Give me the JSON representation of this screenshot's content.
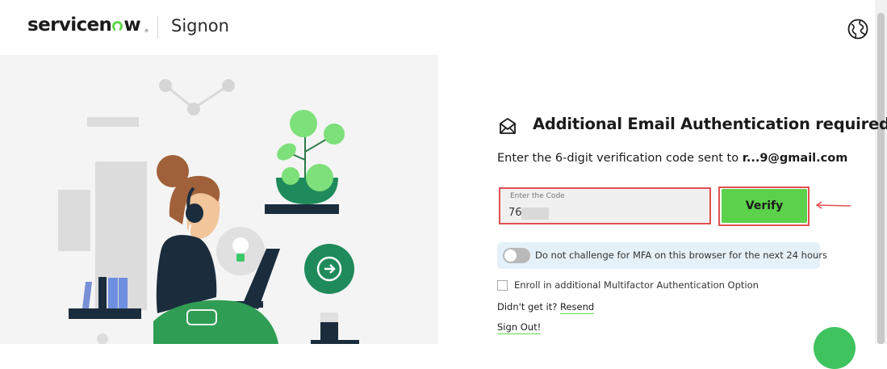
{
  "header": {
    "logo_text_pre": "servicen",
    "logo_text_post": "w",
    "logo_tm": "®",
    "app_name": "Signon",
    "globe_icon": "globe-icon"
  },
  "illustration": {
    "description_icon": "person-with-headset-laptop-illustration"
  },
  "auth": {
    "icon": "mail-icon",
    "title": "Additional Email Authentication required",
    "subtitle_prefix": "Enter the 6-digit verification code sent to ",
    "email_masked": "r...9@gmail.com",
    "code_label": "Enter the Code",
    "code_value": "76",
    "verify_label": "Verify",
    "mfa_toggle_text": "Do not challenge for MFA on this browser for the next 24 hours",
    "enroll_text": "Enroll in additional Multifactor Authentication Option",
    "didnt_get_it": "Didn't get it?",
    "resend_link": "Resend",
    "sign_out_link": "Sign Out!"
  },
  "colors": {
    "accent_green": "#62d84e",
    "verify_button": "#5cd14b",
    "highlight_red": "#e15050",
    "mfa_box_bg": "#e4f1f8",
    "illustration_bg": "#f4f4f4",
    "teal": "#1f8a5b"
  }
}
